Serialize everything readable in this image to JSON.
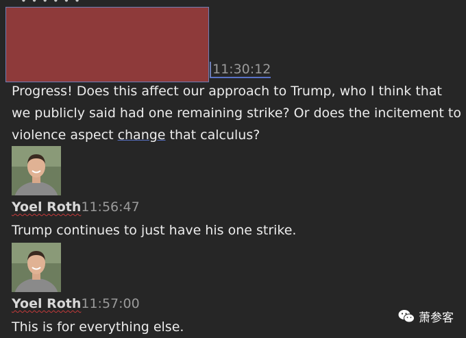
{
  "top_cutoff_text": "• • • • • •",
  "messages": [
    {
      "time": "11:30:12",
      "text_before": "Progress! Does this affect our approach to Trump, who I think that we publicly said had one remaining strike? Or does the incitement to violence aspect ",
      "text_underlined": "change",
      "text_after": " that calculus?"
    },
    {
      "sender": "Yoel Roth",
      "time": "11:56:47",
      "text": "Trump continues to just have his one strike."
    },
    {
      "sender": "Yoel Roth",
      "time": "11:57:00",
      "text": "This is for everything else."
    }
  ],
  "watermark": {
    "text": "萧参客",
    "icon": "wechat-icon"
  },
  "colors": {
    "background": "#262626",
    "redaction": "#8e3a3a",
    "timestamp": "#9a9a9a",
    "text": "#ececec"
  }
}
